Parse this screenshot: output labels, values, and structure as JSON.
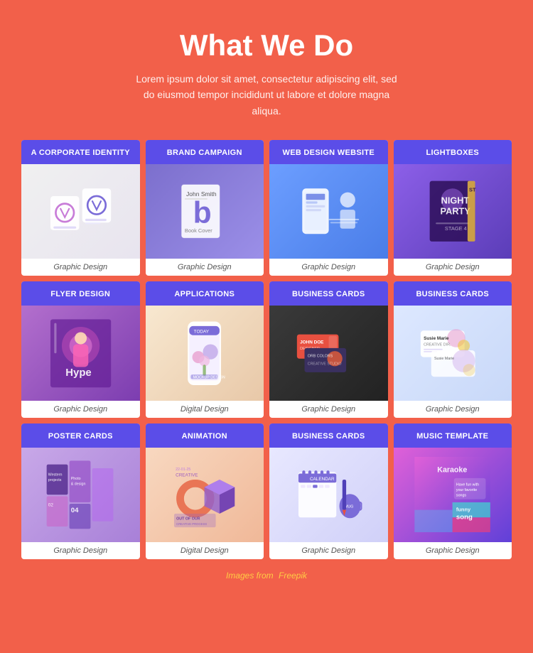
{
  "page": {
    "title": "What We Do",
    "subtitle": "Lorem ipsum dolor sit amet, consectetur adipiscing elit, sed do eiusmod tempor incididunt ut labore et dolore magna aliqua."
  },
  "footer": {
    "text": "Images from",
    "source": "Freepik"
  },
  "grid": {
    "cards": [
      {
        "id": "corporate",
        "header": "A Corporate Identity",
        "footer": "Graphic Design",
        "bg": "corporate",
        "headerColor": "#5b4de8"
      },
      {
        "id": "brand",
        "header": "Brand Campaign",
        "footer": "Graphic Design",
        "bg": "brand",
        "headerColor": "#5b4de8"
      },
      {
        "id": "web",
        "header": "Web Design Website",
        "footer": "Graphic Design",
        "bg": "web",
        "headerColor": "#5b4de8"
      },
      {
        "id": "lightboxes",
        "header": "Lightboxes",
        "footer": "Graphic Design",
        "bg": "lightboxes",
        "headerColor": "#5b4de8"
      },
      {
        "id": "flyer",
        "header": "Flyer design",
        "footer": "Graphic Design",
        "bg": "flyer",
        "headerColor": "#5b4de8"
      },
      {
        "id": "applications",
        "header": "Applications",
        "footer": "Digital Design",
        "bg": "applications",
        "headerColor": "#5b4de8"
      },
      {
        "id": "bizcard1",
        "header": "Business cards",
        "footer": "Graphic Design",
        "bg": "bizcard1",
        "headerColor": "#5b4de8"
      },
      {
        "id": "bizcard2",
        "header": "Business cards",
        "footer": "Graphic Design",
        "bg": "bizcard2",
        "headerColor": "#5b4de8"
      },
      {
        "id": "poster",
        "header": "Poster cards",
        "footer": "Graphic Design",
        "bg": "poster",
        "headerColor": "#5b4de8"
      },
      {
        "id": "animation",
        "header": "Animation",
        "footer": "Digital Design",
        "bg": "animation",
        "headerColor": "#5b4de8"
      },
      {
        "id": "bizcard3",
        "header": "Business cards",
        "footer": "Graphic Design",
        "bg": "bizcard3",
        "headerColor": "#5b4de8"
      },
      {
        "id": "music",
        "header": "Music Template",
        "footer": "Graphic Design",
        "bg": "music",
        "headerColor": "#5b4de8"
      }
    ]
  }
}
